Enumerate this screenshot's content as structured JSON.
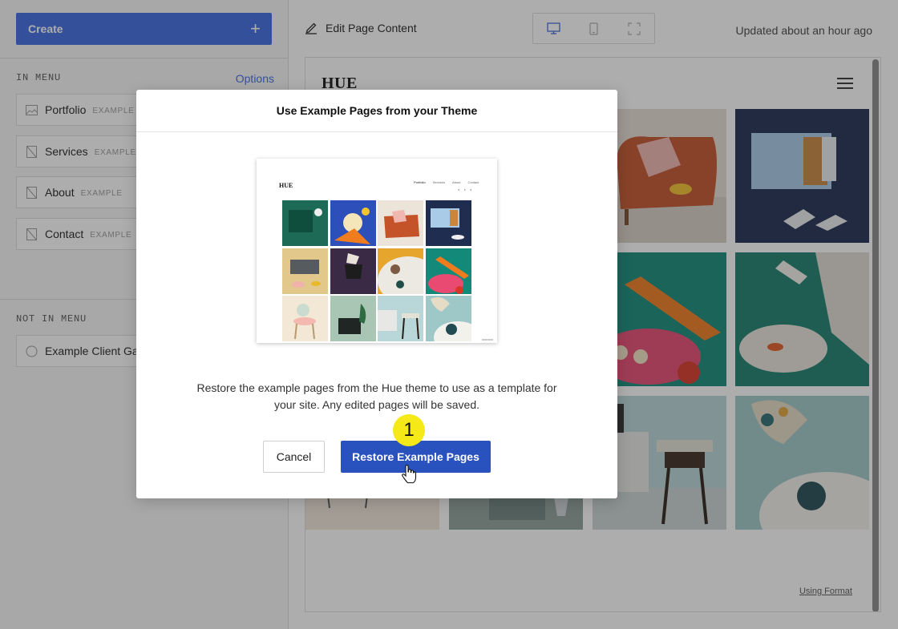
{
  "sidebar": {
    "create_label": "Create",
    "in_menu_label": "IN MENU",
    "options_label": "Options",
    "in_menu_items": [
      {
        "title": "Portfolio",
        "tag": "EXAMPLE",
        "icon": "gallery-icon"
      },
      {
        "title": "Services",
        "tag": "EXAMPLE",
        "icon": "page-icon"
      },
      {
        "title": "About",
        "tag": "EXAMPLE",
        "icon": "page-icon"
      },
      {
        "title": "Contact",
        "tag": "EXAMPLE",
        "icon": "page-icon"
      }
    ],
    "not_in_menu_label": "NOT IN MENU",
    "not_in_menu_items": [
      {
        "title": "Example Client Gallery",
        "icon": "circle-icon"
      }
    ]
  },
  "topbar": {
    "edit_label": "Edit Page Content",
    "updated_text": "Updated about an hour ago",
    "device_icons": [
      "desktop-icon",
      "mobile-icon",
      "fullscreen-icon"
    ]
  },
  "preview": {
    "logo": "HUE",
    "footer_link": "Using Format"
  },
  "modal": {
    "title": "Use Example Pages from your Theme",
    "thumbnail": {
      "logo": "HUE",
      "nav": [
        "Portfolio",
        "Services",
        "About",
        "Contact"
      ]
    },
    "description": "Restore the example pages from the Hue theme to use as a template for your site. Any edited pages will be saved.",
    "cancel_label": "Cancel",
    "restore_label": "Restore Example Pages"
  },
  "step_badge": "1",
  "colors": {
    "accent": "#3e6ae1",
    "restore_button": "#2a52be",
    "badge": "#f5ea17"
  }
}
